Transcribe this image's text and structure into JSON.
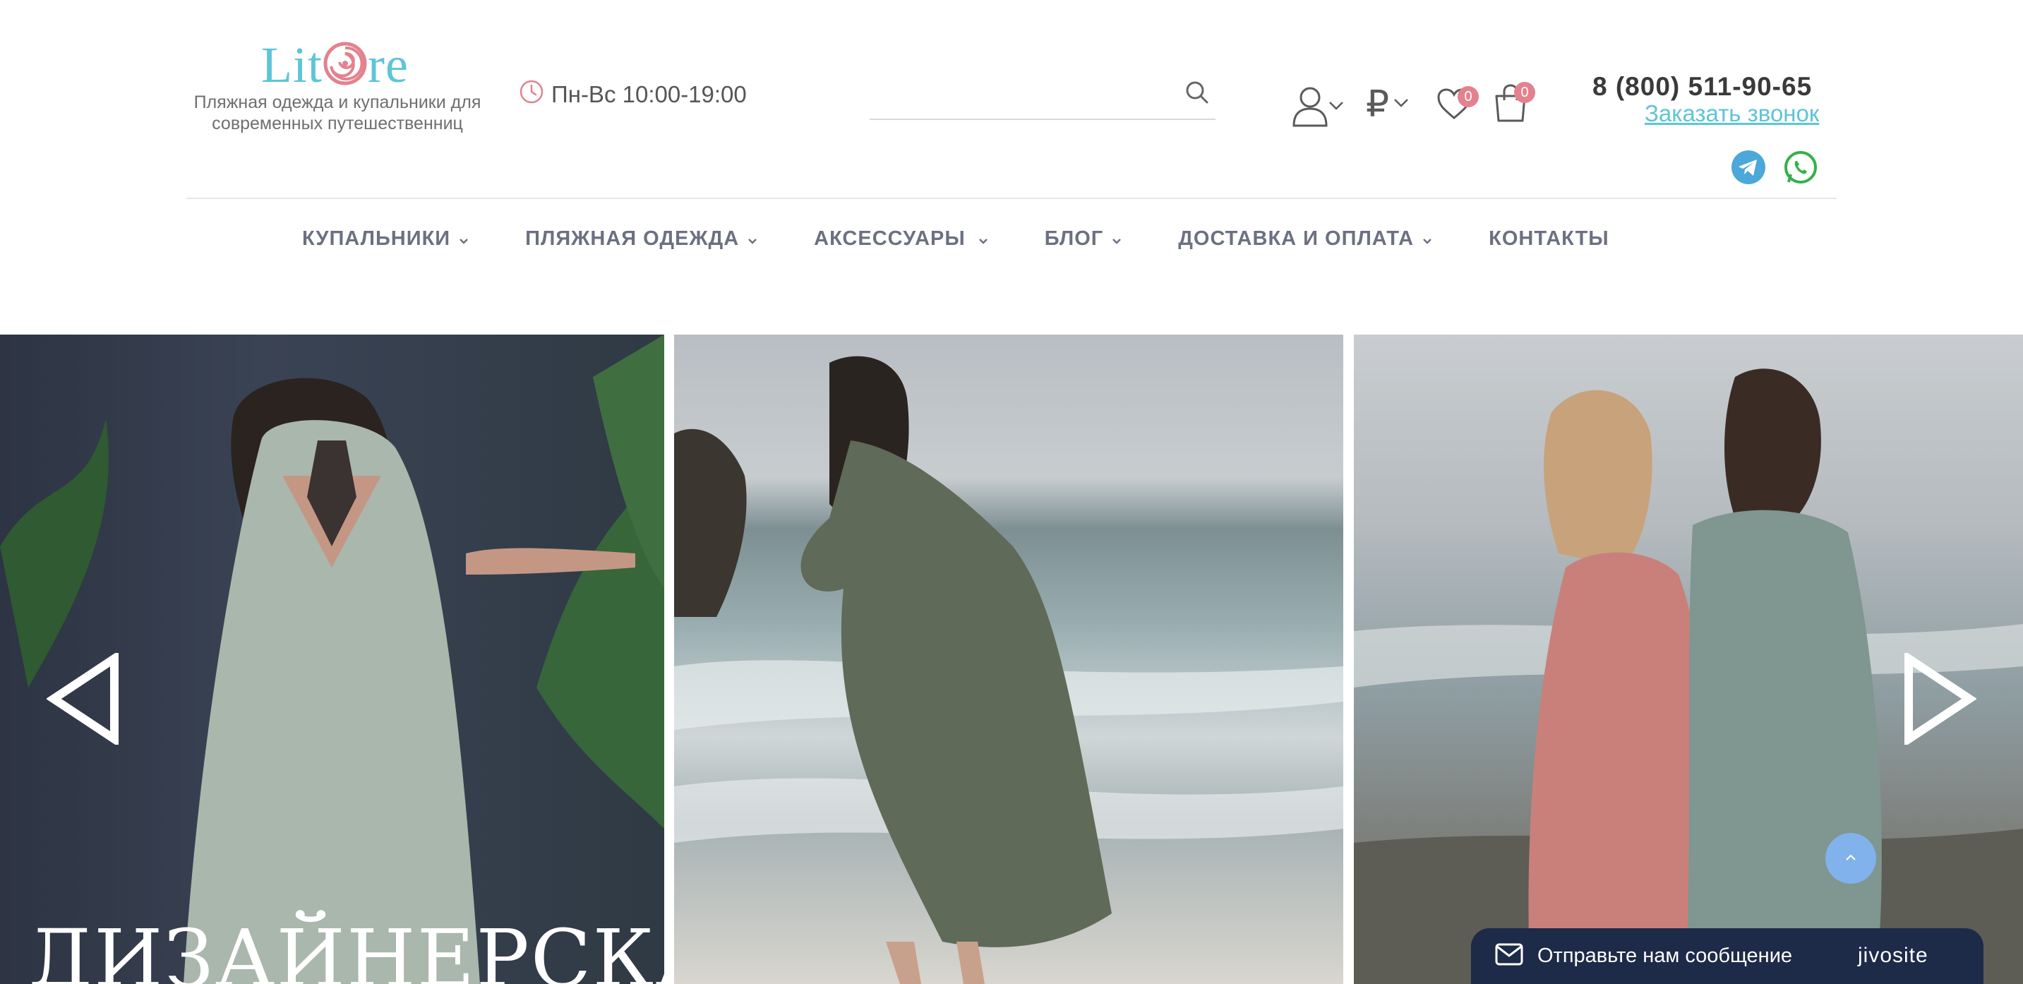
{
  "header": {
    "logo_text_left": "Lit",
    "logo_text_right": "re",
    "tagline_line1": "Пляжная одежда и купальники для",
    "tagline_line2": "современных путешественниц",
    "hours": "Пн-Вс 10:00-19:00",
    "search_placeholder": "",
    "currency_symbol": "₽",
    "wishlist_count": "0",
    "cart_count": "0",
    "phone": "8 (800) 511-90-65",
    "callback_label": "Заказать звонок"
  },
  "nav": {
    "items": [
      {
        "label": "КУПАЛЬНИКИ"
      },
      {
        "label": "ПЛЯЖНАЯ ОДЕЖДА"
      },
      {
        "label": "АКСЕССУАРЫ"
      },
      {
        "label": "БЛОГ"
      },
      {
        "label": "ДОСТАВКА И ОПЛАТА"
      },
      {
        "label": "КОНТАКТЫ"
      }
    ]
  },
  "slider": {
    "slide1_caption": "ДИЗАЙНЕРСКАЯ"
  },
  "chat": {
    "label": "Отправьте нам сообщение",
    "brand": "jivosite"
  },
  "colors": {
    "brand": "#5ec5d6",
    "badge": "#e3828f",
    "nav_text": "#6c7181",
    "chat_bg": "#1d2a48",
    "scroll_top": "#82b2ec"
  },
  "icons": {
    "hours": "clock-icon",
    "search": "search-icon",
    "user": "user-icon",
    "wishlist": "heart-icon",
    "cart": "shopping-bag-icon",
    "messengers": [
      "telegram-icon",
      "whatsapp-icon"
    ]
  }
}
